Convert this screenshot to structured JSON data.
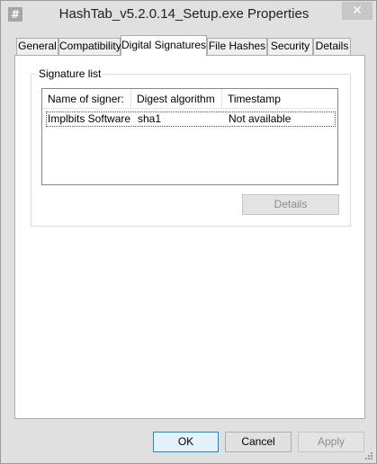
{
  "window": {
    "title": "HashTab_v5.2.0.14_Setup.exe Properties",
    "app_icon_glyph": "#",
    "close_glyph": "✕"
  },
  "tabs": [
    {
      "label": "General",
      "active": false
    },
    {
      "label": "Compatibility",
      "active": false
    },
    {
      "label": "Digital Signatures",
      "active": true
    },
    {
      "label": "File Hashes",
      "active": false
    },
    {
      "label": "Security",
      "active": false
    },
    {
      "label": "Details",
      "active": false
    }
  ],
  "signature_list": {
    "group_label": "Signature list",
    "columns": [
      "Name of signer:",
      "Digest algorithm",
      "Timestamp"
    ],
    "rows": [
      {
        "name": "Implbits Software,...",
        "digest": "sha1",
        "timestamp": "Not available"
      }
    ],
    "details_label": "Details"
  },
  "footer": {
    "ok_label": "OK",
    "cancel_label": "Cancel",
    "apply_label": "Apply"
  },
  "colors": {
    "window_bg": "#e0e0e0",
    "panel_bg": "#ffffff",
    "default_button_border": "#3c7fb1"
  }
}
